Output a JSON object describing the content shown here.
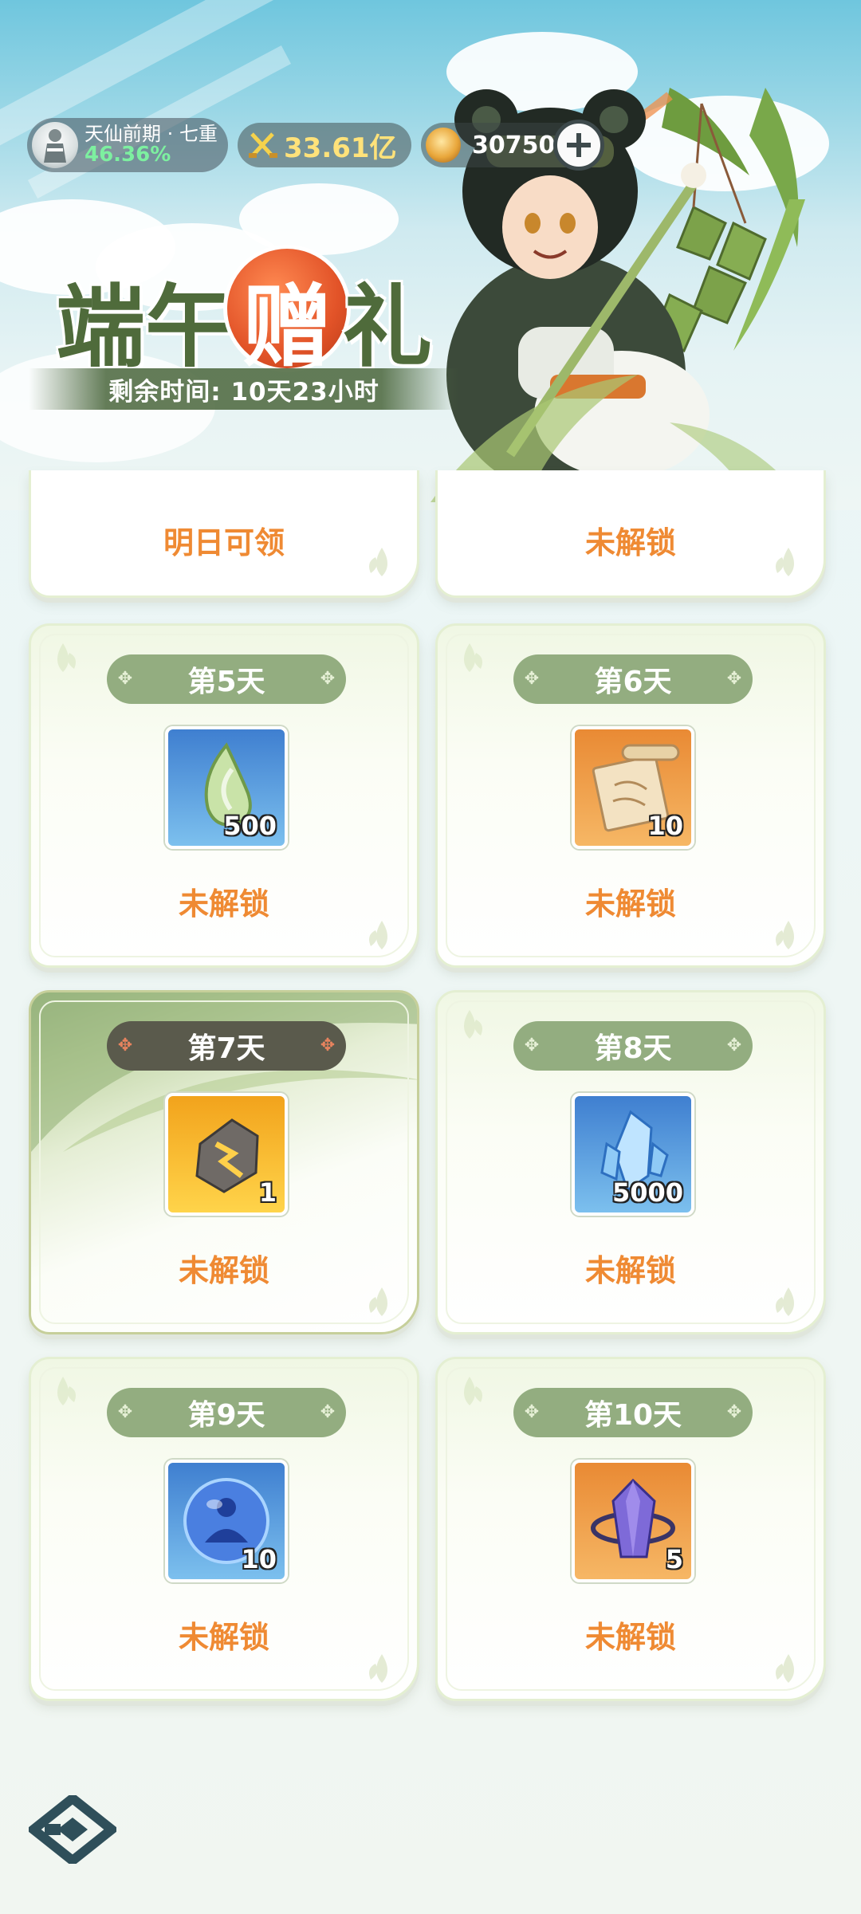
{
  "hud": {
    "realm": "天仙前期 · 七重",
    "realm_progress": "46.36%",
    "power": "33.61亿",
    "currency": "30750",
    "add_button": "+"
  },
  "event": {
    "title_char_1": "端",
    "title_char_2": "午",
    "title_char_3": "赠",
    "title_char_4": "礼",
    "countdown": "剩余时间: 10天23小时"
  },
  "top_cards": [
    {
      "status": "明日可领"
    },
    {
      "status": "未解锁"
    }
  ],
  "cards": [
    {
      "day": "第5天",
      "item": "jade-fragment",
      "count": "500",
      "status": "未解锁"
    },
    {
      "day": "第6天",
      "item": "ancient-scroll",
      "count": "10",
      "status": "未解锁"
    },
    {
      "day": "第7天",
      "item": "thunder-ore",
      "count": "1",
      "status": "未解锁"
    },
    {
      "day": "第8天",
      "item": "spirit-crystal",
      "count": "5000",
      "status": "未解锁"
    },
    {
      "day": "第9天",
      "item": "meditation-orb",
      "count": "10",
      "status": "未解锁"
    },
    {
      "day": "第10天",
      "item": "arcane-crystal",
      "count": "5",
      "status": "未解锁"
    }
  ],
  "colors": {
    "status_orange": "#ef8a33",
    "pill_green": "#93ad80",
    "pill_dark": "#5a5a4c",
    "title_green": "#4f6b3b"
  }
}
